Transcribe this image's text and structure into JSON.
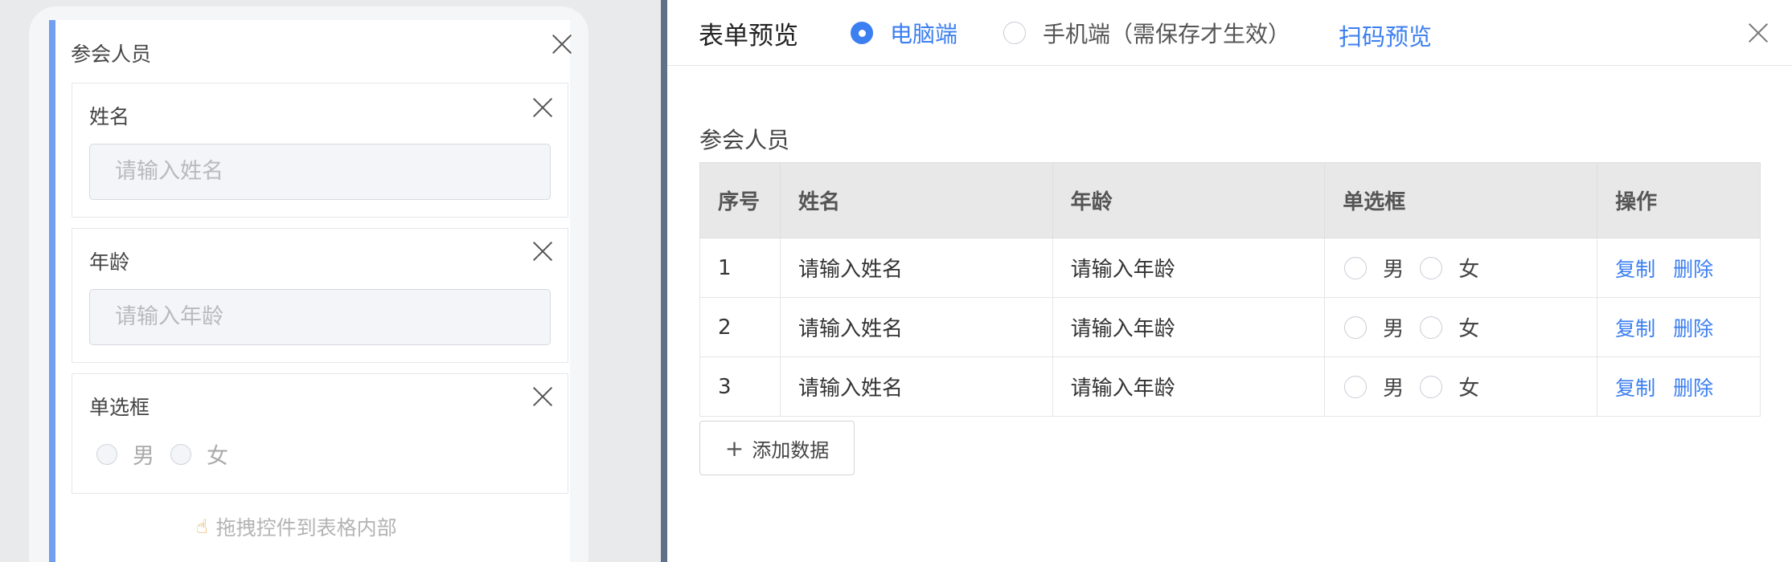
{
  "designer": {
    "subform_title": "参会人员",
    "fields": [
      {
        "label": "姓名",
        "placeholder": "请输入姓名"
      },
      {
        "label": "年龄",
        "placeholder": "请输入年龄"
      },
      {
        "label": "单选框",
        "options": [
          "男",
          "女"
        ]
      }
    ],
    "drag_hint": "拖拽控件到表格内部",
    "hand_glyph": "☝"
  },
  "preview": {
    "title": "表单预览",
    "modes": [
      {
        "label": "电脑端",
        "selected": true
      },
      {
        "label": "手机端（需保存才生效）",
        "selected": false
      }
    ],
    "scan_link": "扫码预览",
    "section_title": "参会人员",
    "columns": [
      "序号",
      "姓名",
      "年龄",
      "单选框",
      "操作"
    ],
    "rows": [
      {
        "index": "1",
        "name_placeholder": "请输入姓名",
        "age_placeholder": "请输入年龄",
        "options": [
          "男",
          "女"
        ],
        "actions": [
          "复制",
          "删除"
        ]
      },
      {
        "index": "2",
        "name_placeholder": "请输入姓名",
        "age_placeholder": "请输入年龄",
        "options": [
          "男",
          "女"
        ],
        "actions": [
          "复制",
          "删除"
        ]
      },
      {
        "index": "3",
        "name_placeholder": "请输入姓名",
        "age_placeholder": "请输入年龄",
        "options": [
          "男",
          "女"
        ],
        "actions": [
          "复制",
          "删除"
        ]
      }
    ],
    "add_button": "添加数据",
    "add_glyph": "+"
  },
  "colors": {
    "accent": "#3c7ff0",
    "canvas_border": "#6f9fee",
    "divider": "#5f7186"
  }
}
